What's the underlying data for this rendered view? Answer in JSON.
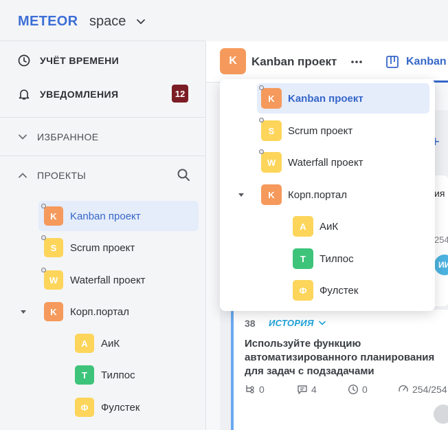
{
  "header": {
    "brand": "METEOR",
    "workspace": "space"
  },
  "nav": {
    "time_tracking": "УЧЁТ ВРЕМЕНИ",
    "notifications": "УВЕДОМЛЕНИЯ",
    "notifications_count": "12",
    "favorites": "ИЗБРАННОЕ",
    "projects": "ПРОЕКТЫ"
  },
  "projects": [
    {
      "letter": "K",
      "name": "Kanban проект",
      "color": "#f59a5c",
      "selected": true
    },
    {
      "letter": "S",
      "name": "Scrum проект",
      "color": "#fdd55a"
    },
    {
      "letter": "W",
      "name": "Waterfall проект",
      "color": "#fdd55a"
    },
    {
      "letter": "K",
      "name": "Корп.портал",
      "color": "#f59a5c",
      "expanded": true
    },
    {
      "letter": "А",
      "name": "АиК",
      "color": "#fdd55a",
      "child": true
    },
    {
      "letter": "Т",
      "name": "Тилпос",
      "color": "#3ec47a",
      "child": true
    },
    {
      "letter": "Ф",
      "name": "Фулстек",
      "color": "#fdd55a",
      "child": true
    }
  ],
  "project_header": {
    "avatar_letter": "K",
    "title": "Kanban проект",
    "tab": "Kanban"
  },
  "board": {
    "peek_text_1": "ия",
    "peek_text_2": "254",
    "peek_avatar": "ИИ",
    "card": {
      "number": "38",
      "type": "ИСТОРИЯ",
      "title": "Используйте функцию автоматизированного планирования для задач с подзадачами",
      "subtasks": "0",
      "comments": "4",
      "time": "0",
      "estimate": "254/254"
    }
  },
  "colors": {
    "accent": "#3566c9",
    "brand": "#3d6fd6",
    "badge": "#7b1d25",
    "story": "#1ea2d8"
  }
}
